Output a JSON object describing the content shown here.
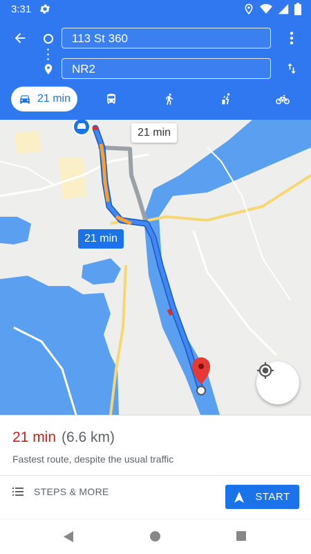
{
  "status_bar": {
    "time": "3:31"
  },
  "directions": {
    "origin": "113 St 360",
    "destination": "NR2"
  },
  "modes": {
    "active_duration": "21 min",
    "items": [
      "car-icon",
      "transit-icon",
      "walk-icon",
      "ride-icon",
      "bike-icon"
    ]
  },
  "map": {
    "primary_route_label": "21 min",
    "alternate_route_label": "21 min"
  },
  "summary": {
    "duration": "21 min",
    "distance": "(6.6 km)",
    "description": "Fastest route, despite the usual traffic"
  },
  "actions": {
    "steps_label": "STEPS & MORE",
    "start_label": "START"
  },
  "colors": {
    "header": "#3078f0",
    "route": "#1a73e8",
    "traffic_slow": "#f9a030",
    "traffic_heavy": "#d93025",
    "water": "#5ba0f0",
    "duration_red": "#c5221f"
  }
}
